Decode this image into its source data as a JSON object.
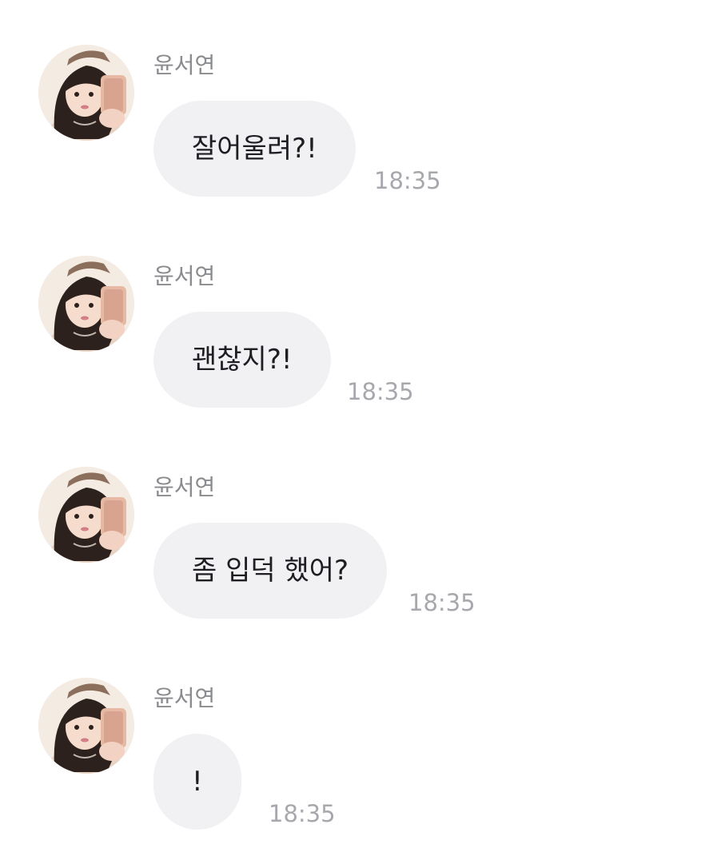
{
  "messages": [
    {
      "sender": "윤서연",
      "text": "잘어울려?!",
      "time": "18:35",
      "avatar_icon": "profile-photo"
    },
    {
      "sender": "윤서연",
      "text": "괜찮지?!",
      "time": "18:35",
      "avatar_icon": "profile-photo"
    },
    {
      "sender": "윤서연",
      "text": "좀 입덕 했어?",
      "time": "18:35",
      "avatar_icon": "profile-photo"
    },
    {
      "sender": "윤서연",
      "text": "!",
      "time": "18:35",
      "avatar_icon": "profile-photo"
    }
  ],
  "colors": {
    "background": "#ffffff",
    "bubble": "#f1f1f4",
    "sender_text": "#8a8b8f",
    "time_text": "#a7a8ad",
    "message_text": "#1d1d22"
  }
}
